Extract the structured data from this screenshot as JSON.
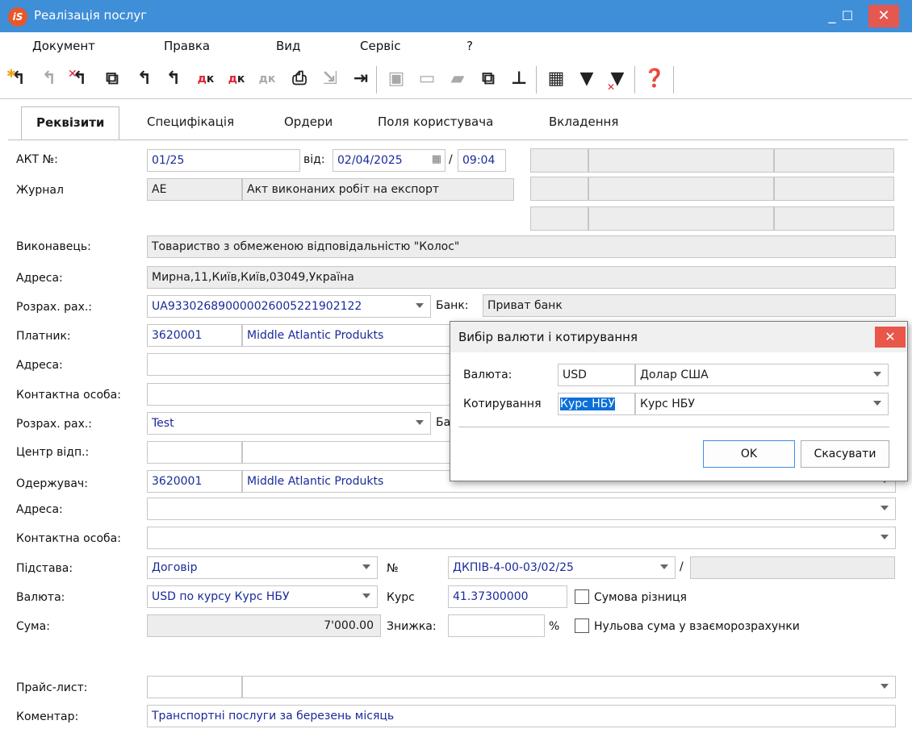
{
  "window": {
    "logo_text": "iS",
    "title": "Реалізація послуг",
    "minimize": "_",
    "maximize": "☐",
    "close": "✕"
  },
  "menu": [
    "Документ",
    "Правка",
    "Вид",
    "Сервіс",
    "?"
  ],
  "toolbar_icons": [
    "new-document-icon",
    "edit-document-icon",
    "delete-document-icon",
    "copy-document-icon",
    "refresh-icon",
    "refresh-alt-icon",
    "debit-credit-icon",
    "debit-credit-alt-icon",
    "debit-credit-disabled-icon",
    "print-icon",
    "export-icon",
    "exit-icon",
    "save-icon",
    "book-icon",
    "folder-icon",
    "link-icon",
    "tree-icon",
    "grid-icon",
    "filter-icon",
    "clear-filter-icon",
    "help-icon"
  ],
  "tabs": [
    "Реквізити",
    "Специфікація",
    "Ордери",
    "Поля користувача",
    "Вкладення"
  ],
  "form": {
    "act_label": "АКТ №:",
    "act_no": "01/25",
    "date_label": "від:",
    "date": "02/04/2025",
    "slash": "/",
    "time": "09:04",
    "journal_label": "Журнал",
    "journal_code": "АЕ",
    "journal_name": "Акт виконаних робіт на експорт",
    "executor_label": "Виконавець:",
    "executor": "Товариство з обмеженою відповідальністю \"Колос\"",
    "address_label": "Адреса:",
    "executor_address": "Мирна,11,Київ,Київ,03049,Україна",
    "account_label": "Розрах. рах.:",
    "executor_account": "UA933026890000026005221902122",
    "bank_label": "Банк:",
    "bank": "Приват банк",
    "bank_label_partial": "Ба",
    "payer_label": "Платник:",
    "payer_code": "3620001",
    "payer_name": "Middle Atlantic Produkts",
    "address2_label": "Адреса:",
    "contact_label": "Контактна особа:",
    "payer_account_label": "Розрах. рах.:",
    "payer_account": "Test",
    "center_label": "Центр відп.:",
    "receiver_label": "Одержувач:",
    "receiver_code": "3620001",
    "receiver_name": "Middle Atlantic Produkts",
    "address3_label": "Адреса:",
    "contact2_label": "Контактна особа:",
    "basis_label": "Підстава:",
    "basis": "Договір",
    "no_label": "№",
    "contract_no": "ДКПІВ-4-00-03/02/25",
    "currency_label": "Валюта:",
    "currency": "USD по курсу Курс НБУ",
    "rate_label": "Курс",
    "rate": "41.37300000",
    "sum_diff_label": "Сумова різниця",
    "sum_label": "Сума:",
    "sum": "7'000.00",
    "discount_label": "Знижка:",
    "percent": "%",
    "zero_sum_label": "Нульова сума у взаєморозрахунки",
    "price_list_label": "Прайс-лист:",
    "comment_label": "Коментар:",
    "comment": "Транспортні послуги за березень місяць"
  },
  "dialog": {
    "title": "Вибір валюти і котирування",
    "close": "✕",
    "currency_label": "Валюта:",
    "currency_code": "USD",
    "currency_name": "Долар США",
    "quote_label": "Котирування",
    "quote_code": "Курс НБУ",
    "quote_name": "Курс НБУ",
    "ok": "OK",
    "cancel": "Скасувати"
  },
  "colors": {
    "titlebar": "#3f8ed8",
    "close": "#e5584f",
    "value_text": "#1a2a9a",
    "selection": "#0a6fd6"
  }
}
